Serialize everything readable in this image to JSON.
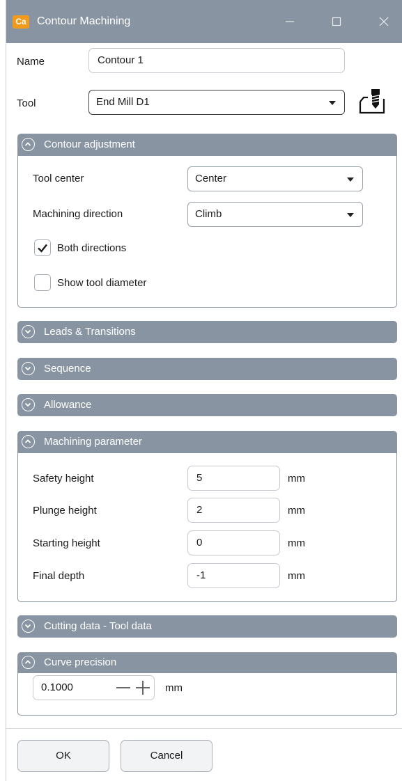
{
  "window": {
    "app_icon_text": "Ca",
    "title": "Contour Machining"
  },
  "form": {
    "name_label": "Name",
    "name_value": "Contour 1",
    "tool_label": "Tool",
    "tool_value": "End Mill D1"
  },
  "contour_adjustment": {
    "title": "Contour adjustment",
    "expanded": true,
    "tool_center_label": "Tool center",
    "tool_center_value": "Center",
    "machining_direction_label": "Machining direction",
    "machining_direction_value": "Climb",
    "both_directions_label": "Both directions",
    "both_directions_checked": true,
    "show_tool_diameter_label": "Show tool diameter",
    "show_tool_diameter_checked": false
  },
  "collapsed_groups": {
    "leads": "Leads & Transitions",
    "sequence": "Sequence",
    "allowance": "Allowance",
    "cutting_data": "Cutting data - Tool data"
  },
  "machining_parameter": {
    "title": "Machining parameter",
    "safety_height_label": "Safety height",
    "safety_height_value": "5",
    "plunge_height_label": "Plunge height",
    "plunge_height_value": "2",
    "starting_height_label": "Starting height",
    "starting_height_value": "0",
    "final_depth_label": "Final depth",
    "final_depth_value": "-1",
    "unit": "mm"
  },
  "curve_precision": {
    "title": "Curve precision",
    "value": "0.1000",
    "unit": "mm"
  },
  "buttons": {
    "ok": "OK",
    "cancel": "Cancel"
  },
  "colors": {
    "header": "#8894a1",
    "app_icon": "#f29a1d"
  }
}
